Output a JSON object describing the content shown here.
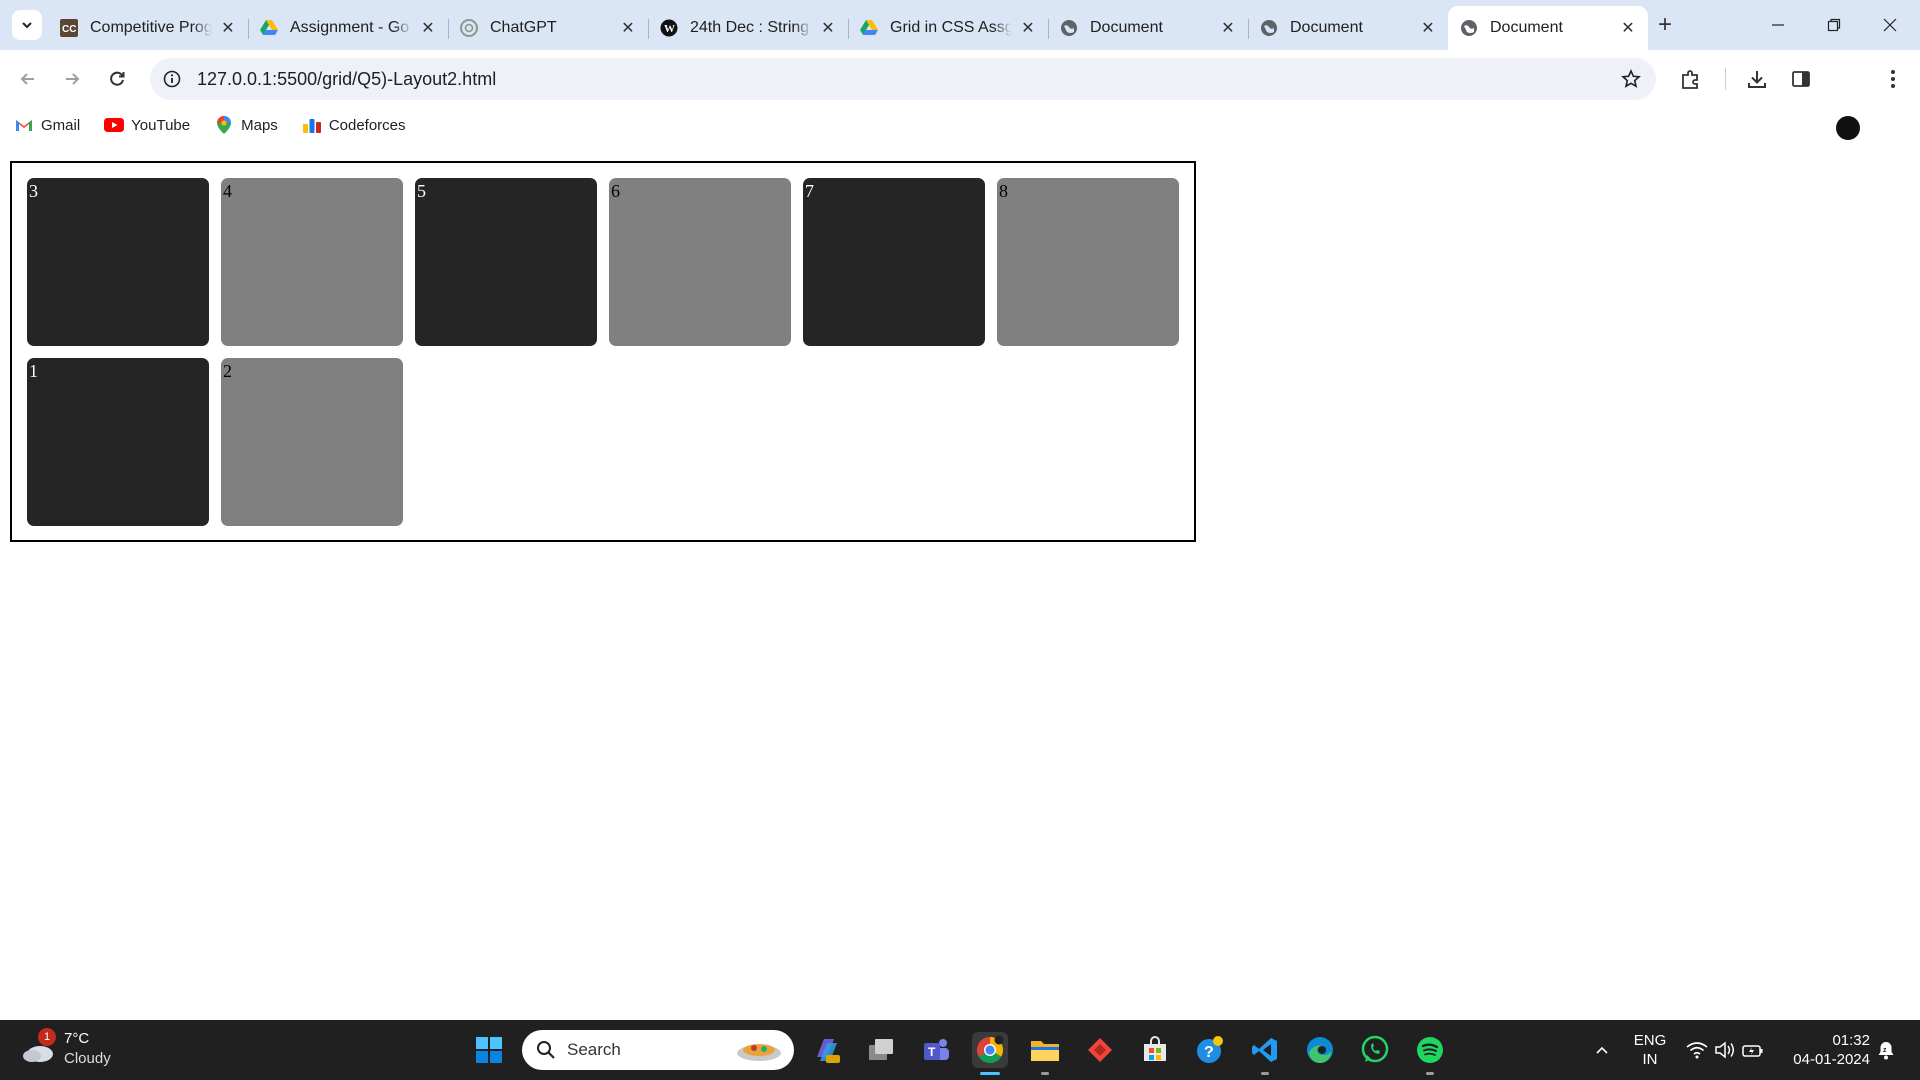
{
  "browser": {
    "tabs": [
      {
        "title": "Competitive Prog",
        "favicon": "cc-icon",
        "active": false
      },
      {
        "title": "Assignment - Go",
        "favicon": "google-drive-icon",
        "active": false
      },
      {
        "title": "ChatGPT",
        "favicon": "chatgpt-icon",
        "active": false
      },
      {
        "title": "24th Dec : String",
        "favicon": "wordpress-icon",
        "active": false
      },
      {
        "title": "Grid in CSS Assg",
        "favicon": "google-drive-icon",
        "active": false
      },
      {
        "title": "Document",
        "favicon": "globe-icon",
        "active": false
      },
      {
        "title": "Document",
        "favicon": "globe-icon",
        "active": false
      },
      {
        "title": "Document",
        "favicon": "globe-icon",
        "active": true
      }
    ],
    "url": "127.0.0.1:5500/grid/Q5)-Layout2.html",
    "bookmarks": [
      {
        "label": "Gmail",
        "icon": "gmail-icon"
      },
      {
        "label": "YouTube",
        "icon": "youtube-icon"
      },
      {
        "label": "Maps",
        "icon": "maps-icon"
      },
      {
        "label": "Codeforces",
        "icon": "codeforces-icon"
      }
    ]
  },
  "page": {
    "boxes": [
      {
        "label": "3",
        "color": "#252525"
      },
      {
        "label": "4",
        "color": "#808080"
      },
      {
        "label": "5",
        "color": "#252525"
      },
      {
        "label": "6",
        "color": "#808080"
      },
      {
        "label": "7",
        "color": "#252525"
      },
      {
        "label": "8",
        "color": "#808080"
      },
      {
        "label": "1",
        "color": "#252525"
      },
      {
        "label": "2",
        "color": "#808080"
      }
    ]
  },
  "taskbar": {
    "weather": {
      "temp": "7°C",
      "condition": "Cloudy",
      "badge": "1"
    },
    "search_placeholder": "Search",
    "language": {
      "line1": "ENG",
      "line2": "IN"
    },
    "clock": {
      "time": "01:32",
      "date": "04-01-2024"
    }
  }
}
